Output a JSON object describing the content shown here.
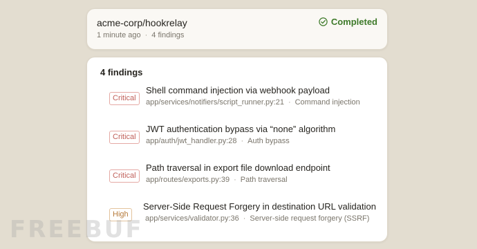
{
  "scan": {
    "repo": "acme-corp/hookrelay",
    "time_ago": "1 minute ago",
    "findings_count_label": "4 findings",
    "status_label": "Completed",
    "status_icon": "check-circle-icon",
    "status_color": "#3e7a2a"
  },
  "findings_panel": {
    "title": "4 findings",
    "items": [
      {
        "severity": "Critical",
        "title": "Shell command injection via webhook payload",
        "location": "app/services/notifiers/script_runner.py:21",
        "category": "Command injection"
      },
      {
        "severity": "Critical",
        "title": "JWT authentication bypass via “none” algorithm",
        "location": "app/auth/jwt_handler.py:28",
        "category": "Auth bypass"
      },
      {
        "severity": "Critical",
        "title": "Path traversal in export file download endpoint",
        "location": "app/routes/exports.py:39",
        "category": "Path traversal"
      },
      {
        "severity": "High",
        "title": "Server-Side Request Forgery in destination URL validation",
        "location": "app/services/validator.py:36",
        "category": "Server-side request forgery (SSRF)"
      }
    ]
  },
  "colors": {
    "critical": "#c0605a",
    "high": "#b57a3a",
    "background": "#e3ddd0"
  },
  "watermark": "FREEBUF"
}
